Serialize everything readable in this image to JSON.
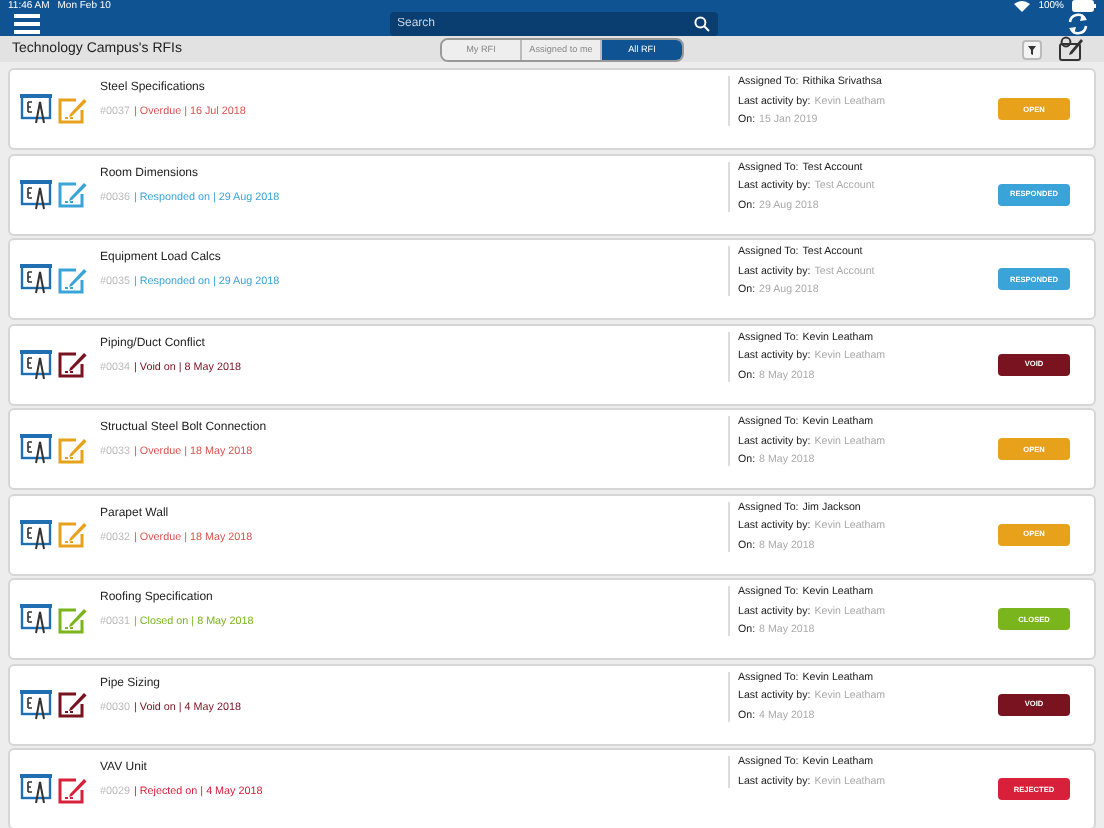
{
  "status_bar": {
    "time": "11:46 AM",
    "date": "Mon Feb 10",
    "battery": "100%"
  },
  "search": {
    "placeholder": "Search"
  },
  "header": {
    "title": "Technology Campus's RFIs"
  },
  "tabs": [
    {
      "label": "My RFI",
      "selected": false
    },
    {
      "label": "Assigned to me",
      "selected": false
    },
    {
      "label": "All RFI",
      "selected": true
    }
  ],
  "rfis": [
    {
      "title": "Steel Specifications",
      "number": "#0037",
      "detail": "| Overdue | 16 Jul 2018",
      "kind": "overdue",
      "assigned_label": "Assigned To:",
      "assigned": "Rithika Srivathsa",
      "activity_label": "Last activity by:",
      "activity": "Kevin Leatham",
      "on_label": "On:",
      "on": "15 Jan 2019",
      "badge": "OPEN",
      "color": "#e8a11a"
    },
    {
      "title": "Room Dimensions",
      "number": "#0036",
      "detail": "| Responded on | 29 Aug 2018",
      "kind": "responded",
      "assigned_label": "Assigned To:",
      "assigned": "Test Account",
      "activity_label": "Last activity by:",
      "activity": "Test Account",
      "on_label": "On:",
      "on": "29 Aug 2018",
      "badge": "RESPONDED",
      "color": "#3aa3d8"
    },
    {
      "title": "Equipment Load Calcs",
      "number": "#0035",
      "detail": "| Responded on | 29 Aug 2018",
      "kind": "responded",
      "assigned_label": "Assigned To:",
      "assigned": "Test Account",
      "activity_label": "Last activity by:",
      "activity": "Test Account",
      "on_label": "On:",
      "on": "29 Aug 2018",
      "badge": "RESPONDED",
      "color": "#3aa3d8"
    },
    {
      "title": "Piping/Duct Conflict",
      "number": "#0034",
      "detail": "| Void on | 8 May 2018",
      "kind": "void",
      "assigned_label": "Assigned To:",
      "assigned": "Kevin Leatham",
      "activity_label": "Last activity by:",
      "activity": "Kevin Leatham",
      "on_label": "On:",
      "on": "8 May 2018",
      "badge": "VOID",
      "color": "#7a1320"
    },
    {
      "title": "Structual Steel Bolt Connection",
      "number": "#0033",
      "detail": "| Overdue | 18 May 2018",
      "kind": "overdue",
      "assigned_label": "Assigned To:",
      "assigned": "Kevin Leatham",
      "activity_label": "Last activity by:",
      "activity": "Kevin Leatham",
      "on_label": "On:",
      "on": "8 May 2018",
      "badge": "OPEN",
      "color": "#e8a11a"
    },
    {
      "title": "Parapet Wall",
      "number": "#0032",
      "detail": "| Overdue | 18 May 2018",
      "kind": "overdue",
      "assigned_label": "Assigned To:",
      "assigned": "Jim Jackson",
      "activity_label": "Last activity by:",
      "activity": "Kevin Leatham",
      "on_label": "On:",
      "on": "8 May 2018",
      "badge": "OPEN",
      "color": "#e8a11a"
    },
    {
      "title": "Roofing Specification",
      "number": "#0031",
      "detail": "| Closed on | 8 May 2018",
      "kind": "closed",
      "assigned_label": "Assigned To:",
      "assigned": "Kevin Leatham",
      "activity_label": "Last activity by:",
      "activity": "Kevin Leatham",
      "on_label": "On:",
      "on": "8 May 2018",
      "badge": "CLOSED",
      "color": "#7ab51d"
    },
    {
      "title": "Pipe Sizing",
      "number": "#0030",
      "detail": "| Void on | 4 May 2018",
      "kind": "void",
      "assigned_label": "Assigned To:",
      "assigned": "Kevin Leatham",
      "activity_label": "Last activity by:",
      "activity": "Kevin Leatham",
      "on_label": "On:",
      "on": "4 May 2018",
      "badge": "VOID",
      "color": "#7a1320"
    },
    {
      "title": "VAV Unit",
      "number": "#0029",
      "detail": "| Rejected on | 4 May 2018",
      "kind": "rejected",
      "assigned_label": "Assigned To:",
      "assigned": "Kevin Leatham",
      "activity_label": "Last activity by:",
      "activity": "Kevin Leatham",
      "badge": "REJECTED",
      "color": "#d9203a"
    }
  ]
}
